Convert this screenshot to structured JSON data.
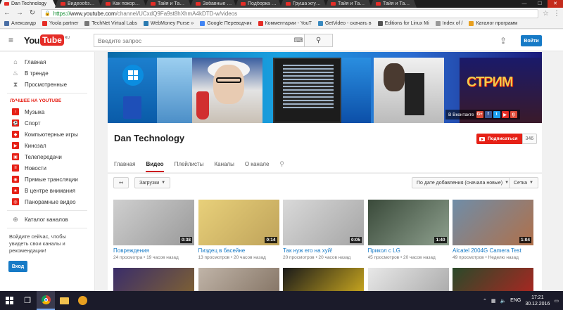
{
  "browser": {
    "tabs": [
      {
        "label": "Dan Technology",
        "active": true
      },
      {
        "label": "Видеообзор ко..."
      },
      {
        "label": "Как покорить..."
      },
      {
        "label": "Тайя и Тайна - ко..."
      },
      {
        "label": "Забавные 13 - ко..."
      },
      {
        "label": "Подборка прикол..."
      },
      {
        "label": "Груша жгучий - ко..."
      },
      {
        "label": "Тайя и Тайна - ко..."
      },
      {
        "label": "Тайя и Тайна - ко..."
      }
    ],
    "url_secure": "https://",
    "url_host": "www.youtube.com",
    "url_path": "/channel/UCxdQ9Fa9st8hXhmA4kDTD-w/videos",
    "bookmarks": [
      "Александр",
      "Yoola partner",
      "TechNet Virtual Labs",
      "WebMoney Purse »",
      "Google Переводчик",
      "Комментарии - YouT",
      "GetVideo - скачать в",
      "Editions for Linux Mi",
      "Index of /",
      "Каталог программ"
    ]
  },
  "masthead": {
    "logo_you": "You",
    "logo_tube": "Tube",
    "logo_region": "RU",
    "search_placeholder": "Введите запрос",
    "signin_label": "Войти"
  },
  "sidebar": {
    "main": [
      {
        "label": "Главная",
        "icon": "home-icon"
      },
      {
        "label": "В тренде",
        "icon": "flame-icon"
      },
      {
        "label": "Просмотренные",
        "icon": "hourglass-icon"
      }
    ],
    "best_heading": "ЛУЧШЕЕ НА YOUTUBE",
    "categories": [
      "Музыка",
      "Спорт",
      "Компьютерные игры",
      "Кинозал",
      "Телепередачи",
      "Новости",
      "Прямые трансляции",
      "В центре внимания",
      "Панорамные видео"
    ],
    "catalog_label": "Каталог каналов",
    "promo_text": "Войдите сейчас, чтобы увидеть свои каналы и рекомендации!",
    "promo_button": "Вход"
  },
  "banner": {
    "stream_text": "СТРИМ",
    "social_label": "В Вконтакте",
    "social_icons": [
      "G+",
      "f",
      "t",
      "▶",
      "g"
    ]
  },
  "channel": {
    "name": "Dan Technology",
    "subscribe_label": "Подписаться",
    "subscriber_count": "346",
    "tabs": [
      "Главная",
      "Видео",
      "Плейлисты",
      "Каналы",
      "О канале"
    ],
    "active_tab": "Видео"
  },
  "toolbar": {
    "back_icon": "↤",
    "uploads_label": "Загрузки",
    "sort_label": "По дате добавления (сначала новые)",
    "view_label": "Сетка"
  },
  "videos": [
    {
      "title": "Повреждения",
      "meta": "24 просмотра • 19 часов назад",
      "duration": "0:38",
      "colors": [
        "#cfcfcf",
        "#9a9a9a"
      ]
    },
    {
      "title": "Пиздец в басейне",
      "meta": "13 просмотров • 20 часов назад",
      "duration": "0:14",
      "colors": [
        "#e8d07a",
        "#bfa35a"
      ]
    },
    {
      "title": "Так нуж его на хуй!",
      "meta": "20 просмотров • 20 часов назад",
      "duration": "0:05",
      "colors": [
        "#d9d9d9",
        "#a5a5a5"
      ]
    },
    {
      "title": "Прикол с LG",
      "meta": "45 просмотров • 20 часов назад",
      "duration": "1:40",
      "colors": [
        "#3a4a3a",
        "#8ea08e"
      ]
    },
    {
      "title": "Alcatel 2004G Camera Test",
      "meta": "49 просмотров • Неделю назад",
      "duration": "1:04",
      "colors": [
        "#6f8da8",
        "#b0704a"
      ]
    },
    {
      "title": "",
      "meta": "",
      "duration": "",
      "colors": [
        "#3a2d6a",
        "#8a6a2a"
      ]
    },
    {
      "title": "",
      "meta": "",
      "duration": "",
      "colors": [
        "#c0b4a8",
        "#7b6a5a"
      ]
    },
    {
      "title": "",
      "meta": "",
      "duration": "",
      "colors": [
        "#1a1a1a",
        "#e8c020"
      ]
    },
    {
      "title": "",
      "meta": "",
      "duration": "",
      "colors": [
        "#e8e8e8",
        "#a0a0a0"
      ]
    },
    {
      "title": "",
      "meta": "",
      "duration": "",
      "colors": [
        "#2a4a2a",
        "#c02020"
      ]
    }
  ],
  "taskbar": {
    "lang": "ENG",
    "time": "17:21",
    "date": "30.12.2016"
  },
  "colors": {
    "youtube_red": "#e62117",
    "link_blue": "#167ac6",
    "signin_blue": "#167ac6"
  }
}
